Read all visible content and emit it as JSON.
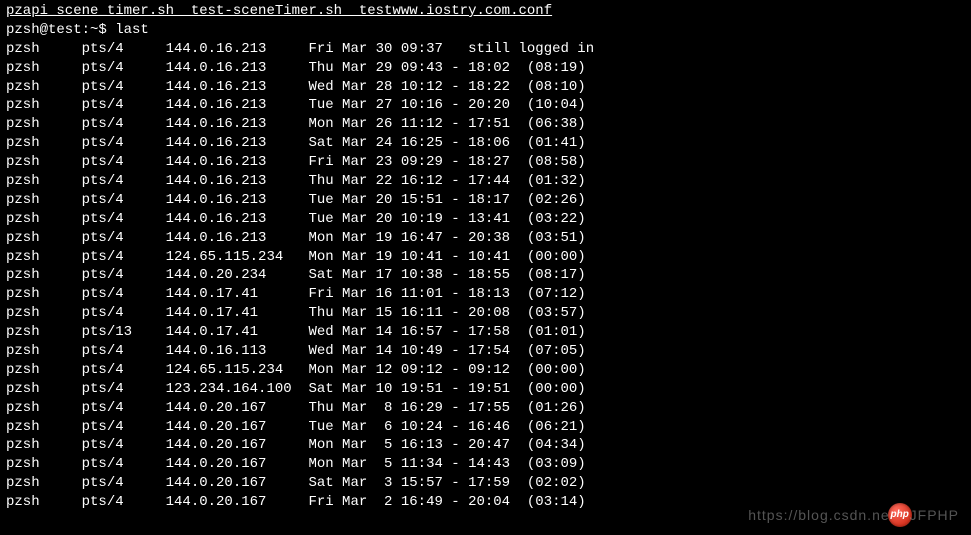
{
  "header_files": "pzapi_scene_timer.sh  test-sceneTimer.sh  testwww.iostry.com.conf",
  "prompt": "pzsh@test:~$ ",
  "command": "last",
  "rows": [
    {
      "user": "pzsh",
      "tty": "pts/4",
      "ip": "144.0.16.213",
      "when": "Fri Mar 30 09:37",
      "rest": "   still logged in"
    },
    {
      "user": "pzsh",
      "tty": "pts/4",
      "ip": "144.0.16.213",
      "when": "Thu Mar 29 09:43",
      "rest": " - 18:02  (08:19)"
    },
    {
      "user": "pzsh",
      "tty": "pts/4",
      "ip": "144.0.16.213",
      "when": "Wed Mar 28 10:12",
      "rest": " - 18:22  (08:10)"
    },
    {
      "user": "pzsh",
      "tty": "pts/4",
      "ip": "144.0.16.213",
      "when": "Tue Mar 27 10:16",
      "rest": " - 20:20  (10:04)"
    },
    {
      "user": "pzsh",
      "tty": "pts/4",
      "ip": "144.0.16.213",
      "when": "Mon Mar 26 11:12",
      "rest": " - 17:51  (06:38)"
    },
    {
      "user": "pzsh",
      "tty": "pts/4",
      "ip": "144.0.16.213",
      "when": "Sat Mar 24 16:25",
      "rest": " - 18:06  (01:41)"
    },
    {
      "user": "pzsh",
      "tty": "pts/4",
      "ip": "144.0.16.213",
      "when": "Fri Mar 23 09:29",
      "rest": " - 18:27  (08:58)"
    },
    {
      "user": "pzsh",
      "tty": "pts/4",
      "ip": "144.0.16.213",
      "when": "Thu Mar 22 16:12",
      "rest": " - 17:44  (01:32)"
    },
    {
      "user": "pzsh",
      "tty": "pts/4",
      "ip": "144.0.16.213",
      "when": "Tue Mar 20 15:51",
      "rest": " - 18:17  (02:26)"
    },
    {
      "user": "pzsh",
      "tty": "pts/4",
      "ip": "144.0.16.213",
      "when": "Tue Mar 20 10:19",
      "rest": " - 13:41  (03:22)"
    },
    {
      "user": "pzsh",
      "tty": "pts/4",
      "ip": "144.0.16.213",
      "when": "Mon Mar 19 16:47",
      "rest": " - 20:38  (03:51)"
    },
    {
      "user": "pzsh",
      "tty": "pts/4",
      "ip": "124.65.115.234",
      "when": "Mon Mar 19 10:41",
      "rest": " - 10:41  (00:00)"
    },
    {
      "user": "pzsh",
      "tty": "pts/4",
      "ip": "144.0.20.234",
      "when": "Sat Mar 17 10:38",
      "rest": " - 18:55  (08:17)"
    },
    {
      "user": "pzsh",
      "tty": "pts/4",
      "ip": "144.0.17.41",
      "when": "Fri Mar 16 11:01",
      "rest": " - 18:13  (07:12)"
    },
    {
      "user": "pzsh",
      "tty": "pts/4",
      "ip": "144.0.17.41",
      "when": "Thu Mar 15 16:11",
      "rest": " - 20:08  (03:57)"
    },
    {
      "user": "pzsh",
      "tty": "pts/13",
      "ip": "144.0.17.41",
      "when": "Wed Mar 14 16:57",
      "rest": " - 17:58  (01:01)"
    },
    {
      "user": "pzsh",
      "tty": "pts/4",
      "ip": "144.0.16.113",
      "when": "Wed Mar 14 10:49",
      "rest": " - 17:54  (07:05)"
    },
    {
      "user": "pzsh",
      "tty": "pts/4",
      "ip": "124.65.115.234",
      "when": "Mon Mar 12 09:12",
      "rest": " - 09:12  (00:00)"
    },
    {
      "user": "pzsh",
      "tty": "pts/4",
      "ip": "123.234.164.100",
      "when": "Sat Mar 10 19:51",
      "rest": " - 19:51  (00:00)"
    },
    {
      "user": "pzsh",
      "tty": "pts/4",
      "ip": "144.0.20.167",
      "when": "Thu Mar  8 16:29",
      "rest": " - 17:55  (01:26)"
    },
    {
      "user": "pzsh",
      "tty": "pts/4",
      "ip": "144.0.20.167",
      "when": "Tue Mar  6 10:24",
      "rest": " - 16:46  (06:21)"
    },
    {
      "user": "pzsh",
      "tty": "pts/4",
      "ip": "144.0.20.167",
      "when": "Mon Mar  5 16:13",
      "rest": " - 20:47  (04:34)"
    },
    {
      "user": "pzsh",
      "tty": "pts/4",
      "ip": "144.0.20.167",
      "when": "Mon Mar  5 11:34",
      "rest": " - 14:43  (03:09)"
    },
    {
      "user": "pzsh",
      "tty": "pts/4",
      "ip": "144.0.20.167",
      "when": "Sat Mar  3 15:57",
      "rest": " - 17:59  (02:02)"
    },
    {
      "user": "pzsh",
      "tty": "pts/4",
      "ip": "144.0.20.167",
      "when": "Fri Mar  2 16:49",
      "rest": " - 20:04  (03:14)"
    }
  ],
  "watermark": {
    "left": "https://blog.csdn.ne",
    "badge": "php",
    "right": "JFPHP"
  }
}
